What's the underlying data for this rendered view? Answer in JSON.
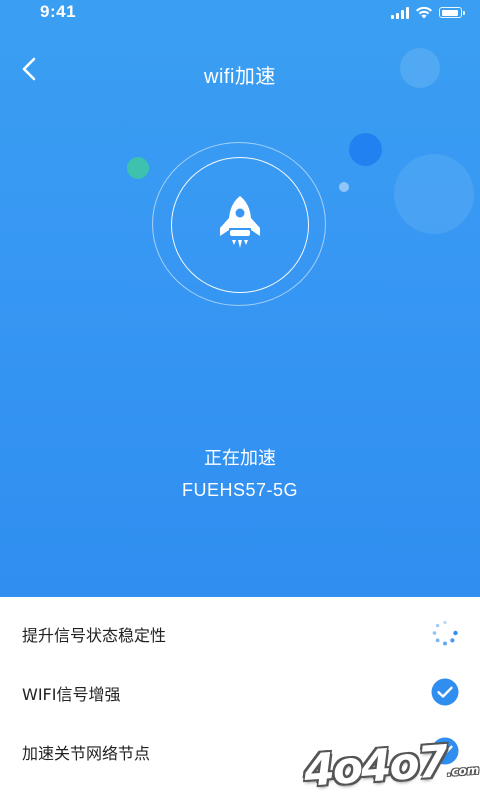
{
  "status_bar": {
    "time": "9:41",
    "icons": [
      "signal-icon",
      "wifi-icon",
      "battery-icon"
    ]
  },
  "nav": {
    "back_icon": "chevron-left-icon",
    "title": "wifi加速"
  },
  "accelerator": {
    "icon": "rocket-icon",
    "status": "正在加速",
    "ssid": "FUEHS57-5G"
  },
  "tasks": [
    {
      "label": "提升信号状态稳定性",
      "state": "in-progress",
      "icon": "loading-spinner-icon"
    },
    {
      "label": "WIFI信号增强",
      "state": "done",
      "icon": "check-circle-icon"
    },
    {
      "label": "加速关节网络节点",
      "state": "done",
      "icon": "check-circle-icon"
    }
  ],
  "watermark": {
    "text": "4o4o7",
    "suffix": ".com"
  },
  "colors": {
    "primary": "#3797f3",
    "accent_dot": "#3ec6a8",
    "check": "#2f8ef0",
    "text": "#222222"
  }
}
